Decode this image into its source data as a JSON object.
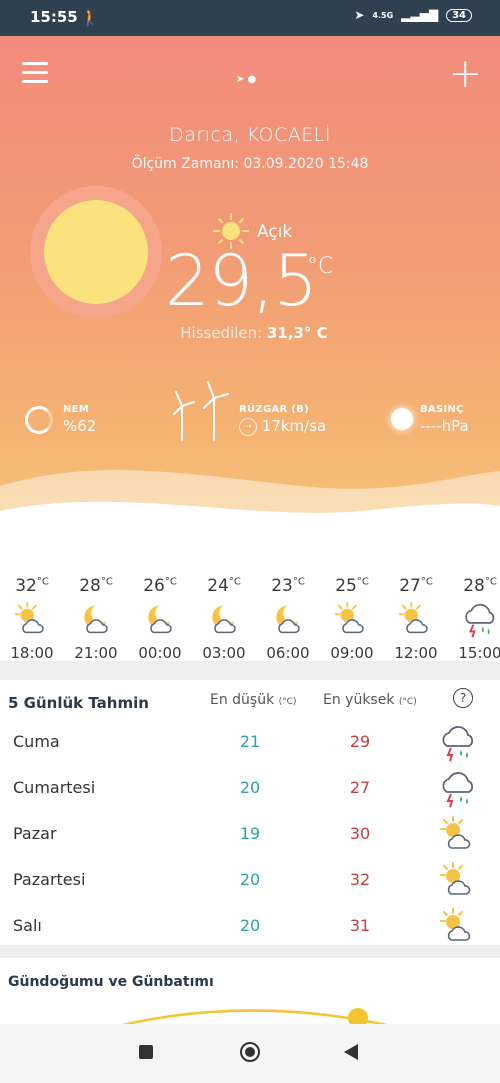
{
  "status_bar": {
    "time": "15:55",
    "network": "4.5G",
    "battery": "34"
  },
  "header": {
    "location": "Darıca,  KOCAELİ",
    "measurement_time": "Ölçüm Zamanı: 03.09.2020 15:48"
  },
  "current": {
    "condition": "Açık",
    "temperature": "29,5",
    "unit": "°C",
    "feels_label": "Hissedilen:",
    "feels_value": "31,3° C"
  },
  "stats": {
    "humidity_label": "NEM",
    "humidity_value": "%62",
    "wind_label": "RÜZGAR (B)",
    "wind_value": "17km/sa",
    "pressure_label": "BASINÇ",
    "pressure_value": "----hPa"
  },
  "hourly": [
    {
      "temp": "32",
      "unit": "°C",
      "time": "18:00",
      "icon": "sun-cloud-icon"
    },
    {
      "temp": "28",
      "unit": "°C",
      "time": "21:00",
      "icon": "moon-cloud-icon"
    },
    {
      "temp": "26",
      "unit": "°C",
      "time": "00:00",
      "icon": "moon-cloud-icon"
    },
    {
      "temp": "24",
      "unit": "°C",
      "time": "03:00",
      "icon": "moon-cloud-icon"
    },
    {
      "temp": "23",
      "unit": "°C",
      "time": "06:00",
      "icon": "moon-cloud-icon"
    },
    {
      "temp": "25",
      "unit": "°C",
      "time": "09:00",
      "icon": "sun-cloud-icon"
    },
    {
      "temp": "27",
      "unit": "°C",
      "time": "12:00",
      "icon": "sun-cloud-icon"
    },
    {
      "temp": "28",
      "unit": "°C",
      "time": "15:00",
      "icon": "storm-icon"
    }
  ],
  "daily": {
    "title": "5 Günlük Tahmin",
    "low_label": "En düşük",
    "high_label": "En yüksek",
    "unit_label": "(°C)",
    "help": "?",
    "days": [
      {
        "name": "Cuma",
        "low": "21",
        "high": "29",
        "icon": "storm-icon"
      },
      {
        "name": "Cumartesi",
        "low": "20",
        "high": "27",
        "icon": "storm-icon"
      },
      {
        "name": "Pazar",
        "low": "19",
        "high": "30",
        "icon": "sun-cloud-icon"
      },
      {
        "name": "Pazartesi",
        "low": "20",
        "high": "32",
        "icon": "sun-cloud-icon"
      },
      {
        "name": "Salı",
        "low": "20",
        "high": "31",
        "icon": "sun-cloud-icon"
      }
    ]
  },
  "sunrise": {
    "title": "Gündoğumu ve Günbatımı"
  },
  "colors": {
    "low": "#2aa3a9",
    "high": "#c73d3d",
    "sun": "#fbe27c",
    "accent": "#f28c7c"
  }
}
